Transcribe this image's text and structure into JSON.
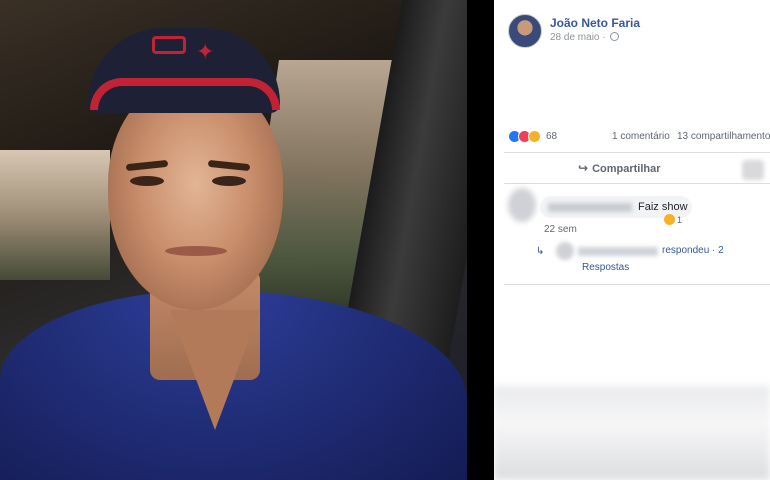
{
  "post": {
    "author": "João Neto Faria",
    "date": "28 de maio ·",
    "reactions_count": "68",
    "comments_count": "1 comentário",
    "shares_count": "13 compartilhamento",
    "share_label": "Compartilhar"
  },
  "comment": {
    "text": "Faiz show",
    "reaction_count": "1",
    "time": "22 sem"
  },
  "reply": {
    "text": "respondeu · 2",
    "more": "Respostas"
  },
  "icons": {
    "globe": "globe-icon",
    "share": "share-icon",
    "reply_arrow": "reply-arrow-icon"
  },
  "colors": {
    "author_link": "#385898",
    "like": "#2078f4",
    "love": "#f33e58",
    "haha": "#f7b125"
  }
}
